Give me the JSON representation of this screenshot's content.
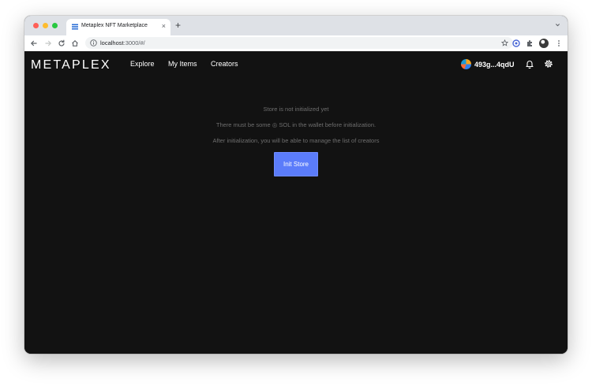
{
  "browser": {
    "tab": {
      "title": "Metaplex NFT Marketplace",
      "close_glyph": "×",
      "favicon": "metaplex-favicon-icon"
    },
    "new_tab_glyph": "+",
    "address_bar": {
      "host": "localhost",
      "path": ":3000/#/"
    }
  },
  "app": {
    "logo": "METAPLEX",
    "nav": {
      "explore": "Explore",
      "my_items": "My Items",
      "creators": "Creators"
    },
    "wallet": {
      "address": "493g...4qdU"
    },
    "store": {
      "line1": "Store is not initialized yet",
      "line2": "There must be some ◎ SOL in the wallet before initialization.",
      "line3": "After initialization, you will be able to manage the list of creators",
      "button_label": "Init Store"
    }
  },
  "colors": {
    "background": "#121212",
    "button": "#5b7cfa",
    "muted_text": "#6e6e6e"
  }
}
